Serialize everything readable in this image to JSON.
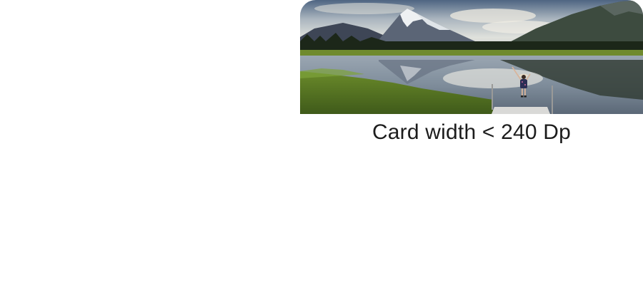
{
  "caption": {
    "text": "Card width < 240 Dp"
  },
  "card_image": {
    "alt": "Mountain lake landscape with a person standing on a dock",
    "colors": {
      "sky_top": "#5a6f86",
      "sky_bottom": "#cfd6dc",
      "mountain_far": "#4a5566",
      "snow": "#e8ecef",
      "treeline": "#1f2a1c",
      "grass": "#6f8f2c",
      "water": "#8c9bab",
      "dock": "#d8d8d8"
    }
  }
}
